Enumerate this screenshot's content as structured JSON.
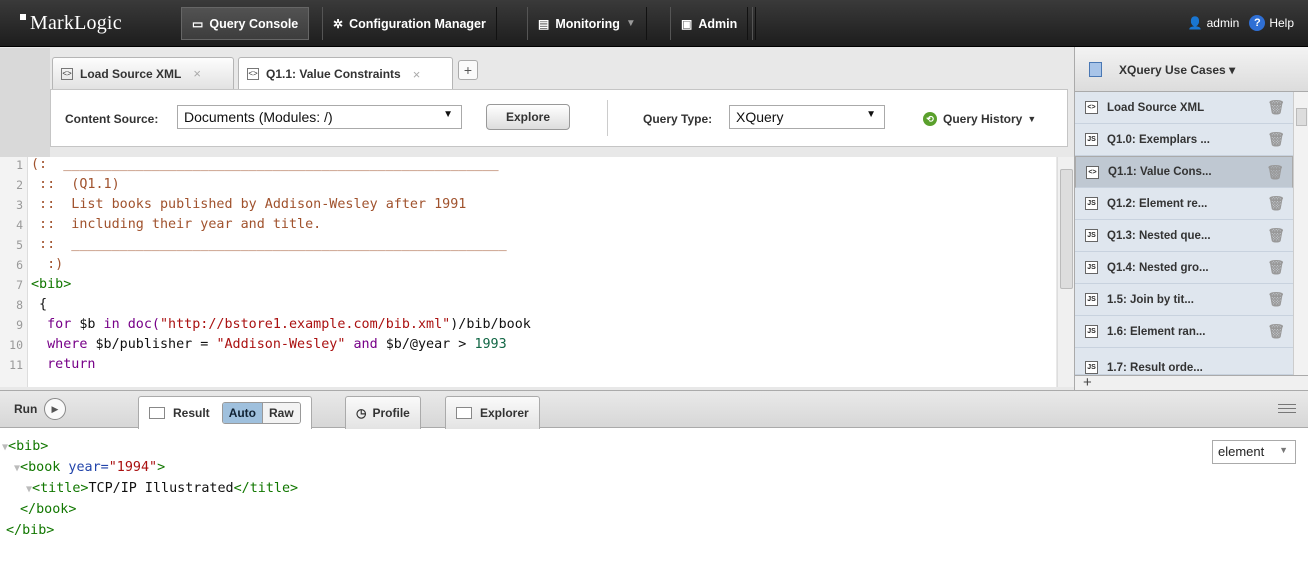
{
  "app": {
    "brand": "MarkLogic"
  },
  "nav": {
    "query_console": "Query Console",
    "configuration_manager": "Configuration Manager",
    "monitoring": "Monitoring",
    "admin": "Admin",
    "user": "admin",
    "help": "Help"
  },
  "tabs": [
    {
      "label": "Load Source XML",
      "close": "×",
      "active": false
    },
    {
      "label": "Q1.1: Value Constraints",
      "close": "×",
      "active": true
    }
  ],
  "add_tab": "+",
  "toolbar": {
    "content_source_label": "Content Source:",
    "content_source_value": "Documents (Modules: /)",
    "explore_label": "Explore",
    "query_type_label": "Query Type:",
    "query_type_value": "XQuery",
    "query_history_label": "Query History"
  },
  "editor": {
    "line_numbers": [
      "1",
      "2",
      "3",
      "4",
      "5",
      "6",
      "7",
      "8",
      "9",
      "10",
      "11"
    ],
    "line1": "(:  ______________________________________________________",
    "line2": " ::  (Q1.1)",
    "line3": " ::  List books published by Addison-Wesley after 1991",
    "line4": " ::  including their year and title.",
    "line5": " ::  ______________________________________________________",
    "line6": "  :)",
    "line7": "<bib>",
    "line8": " {",
    "l9a": "  for ",
    "l9b": "$b",
    "l9c": " in doc(",
    "l9d": "\"http://bstore1.example.com/bib.xml\"",
    "l9e": ")/bib/book",
    "l10a": "  where ",
    "l10b": "$b",
    "l10c": "/publisher = ",
    "l10d": "\"Addison-Wesley\"",
    "l10e": " and ",
    "l10f": "$b",
    "l10g": "/@year > ",
    "l10h": "1993",
    "line11": "  return"
  },
  "workspace": {
    "title": "XQuery Use Cases",
    "items": [
      {
        "label": "Load Source XML",
        "type": "xml",
        "selected": false
      },
      {
        "label": "Q1.0: Exemplars ...",
        "type": "js",
        "selected": false
      },
      {
        "label": "Q1.1: Value Cons...",
        "type": "xml",
        "selected": true
      },
      {
        "label": "Q1.2: Element re...",
        "type": "js",
        "selected": false
      },
      {
        "label": "Q1.3: Nested que...",
        "type": "js",
        "selected": false
      },
      {
        "label": "Q1.4: Nested gro...",
        "type": "js",
        "selected": false
      },
      {
        "label": "1.5: Join by tit...",
        "type": "js",
        "selected": false
      },
      {
        "label": "1.6: Element ran...",
        "type": "js",
        "selected": false
      },
      {
        "label": "1.7: Result orde...",
        "type": "js",
        "selected": false
      }
    ],
    "add": "+"
  },
  "results_bar": {
    "run_label": "Run",
    "result_tab": "Result",
    "auto": "Auto",
    "raw": "Raw",
    "profile_tab": "Profile",
    "explorer_tab": "Explorer"
  },
  "result": {
    "format": "element",
    "r1": "<bib>",
    "r2a": "<book ",
    "r2b": "year=",
    "r2c": "\"1994\"",
    "r2d": ">",
    "r3a": "<title>",
    "r3b": "TCP/IP Illustrated",
    "r3c": "</title>",
    "r4": "</book>",
    "r5": "</bib>"
  },
  "colors": {
    "comment": "#a0522d",
    "tag": "#117700",
    "keyword": "#770088",
    "string": "#aa1111",
    "selection": "#bfc8d2",
    "auto_toggle": "#9fc0dd"
  }
}
